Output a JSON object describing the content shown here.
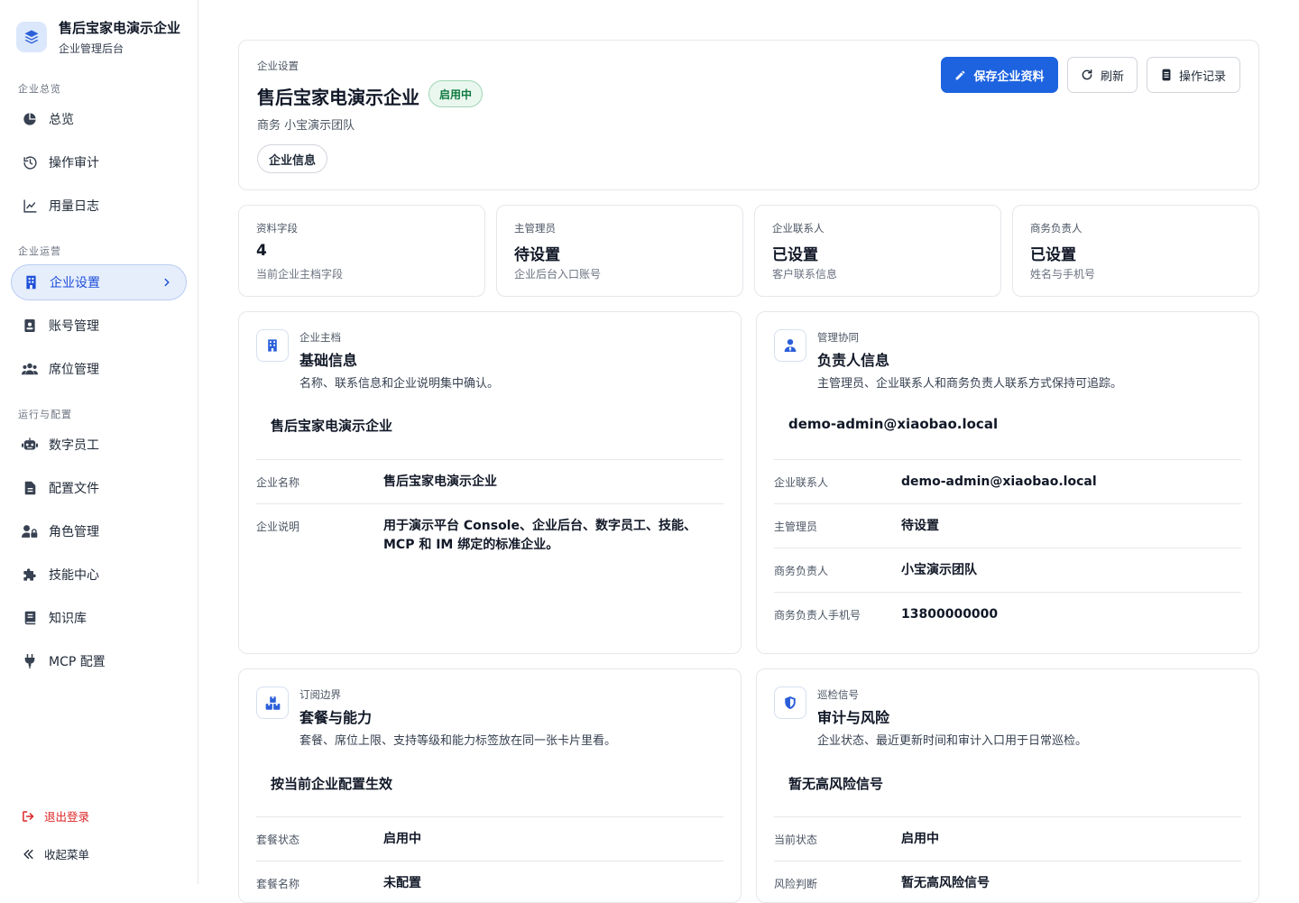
{
  "brand": {
    "title": "售后宝家电演示企业",
    "subtitle": "企业管理后台",
    "logo_icon": "layers-icon"
  },
  "sidebar": {
    "sections": [
      "企业总览",
      "企业运营",
      "运行与配置"
    ],
    "items": [
      {
        "label": "总览",
        "icon": "pie-chart-icon"
      },
      {
        "label": "操作审计",
        "icon": "history-icon"
      },
      {
        "label": "用量日志",
        "icon": "line-chart-icon"
      },
      {
        "label": "企业设置",
        "icon": "building-icon",
        "active": true
      },
      {
        "label": "账号管理",
        "icon": "id-badge-icon"
      },
      {
        "label": "席位管理",
        "icon": "users-icon"
      },
      {
        "label": "数字员工",
        "icon": "robot-icon"
      },
      {
        "label": "配置文件",
        "icon": "file-icon"
      },
      {
        "label": "角色管理",
        "icon": "user-lock-icon"
      },
      {
        "label": "技能中心",
        "icon": "puzzle-icon"
      },
      {
        "label": "知识库",
        "icon": "book-icon"
      },
      {
        "label": "MCP 配置",
        "icon": "plug-icon"
      }
    ],
    "logout": "退出登录",
    "collapse": "收起菜单"
  },
  "header": {
    "kicker": "企业设置",
    "title": "售后宝家电演示企业",
    "status_badge": "启用中",
    "subtitle": "商务 小宝演示团队",
    "tag": "企业信息",
    "buttons": {
      "save": "保存企业资料",
      "refresh": "刷新",
      "log": "操作记录"
    }
  },
  "stats": [
    {
      "label": "资料字段",
      "value": "4",
      "desc": "当前企业主档字段"
    },
    {
      "label": "主管理员",
      "value": "待设置",
      "desc": "企业后台入口账号"
    },
    {
      "label": "企业联系人",
      "value": "已设置",
      "desc": "客户联系信息"
    },
    {
      "label": "商务负责人",
      "value": "已设置",
      "desc": "姓名与手机号"
    }
  ],
  "sections": {
    "basic": {
      "kicker": "企业主档",
      "title": "基础信息",
      "desc": "名称、联系信息和企业说明集中确认。",
      "highlight": "售后宝家电演示企业",
      "rows": [
        {
          "label": "企业名称",
          "value": "售后宝家电演示企业"
        },
        {
          "label": "企业说明",
          "value": "用于演示平台 Console、企业后台、数字员工、技能、MCP 和 IM 绑定的标准企业。"
        }
      ]
    },
    "owner": {
      "kicker": "管理协同",
      "title": "负责人信息",
      "desc": "主管理员、企业联系人和商务负责人联系方式保持可追踪。",
      "highlight": "demo-admin@xiaobao.local",
      "rows": [
        {
          "label": "企业联系人",
          "value": "demo-admin@xiaobao.local"
        },
        {
          "label": "主管理员",
          "value": "待设置"
        },
        {
          "label": "商务负责人",
          "value": "小宝演示团队"
        },
        {
          "label": "商务负责人手机号",
          "value": "13800000000"
        }
      ]
    },
    "plan": {
      "kicker": "订阅边界",
      "title": "套餐与能力",
      "desc": "套餐、席位上限、支持等级和能力标签放在同一张卡片里看。",
      "highlight": "按当前企业配置生效",
      "rows": [
        {
          "label": "套餐状态",
          "value": "启用中"
        },
        {
          "label": "套餐名称",
          "value": "未配置"
        }
      ]
    },
    "audit": {
      "kicker": "巡检信号",
      "title": "审计与风险",
      "desc": "企业状态、最近更新时间和审计入口用于日常巡检。",
      "highlight": "暂无高风险信号",
      "rows": [
        {
          "label": "当前状态",
          "value": "启用中"
        },
        {
          "label": "风险判断",
          "value": "暂无高风险信号"
        }
      ]
    }
  },
  "colors": {
    "accent": "#1d63e0",
    "active_bg": "#e6eefc",
    "success": "#0e7a3e",
    "danger": "#dc2626"
  }
}
